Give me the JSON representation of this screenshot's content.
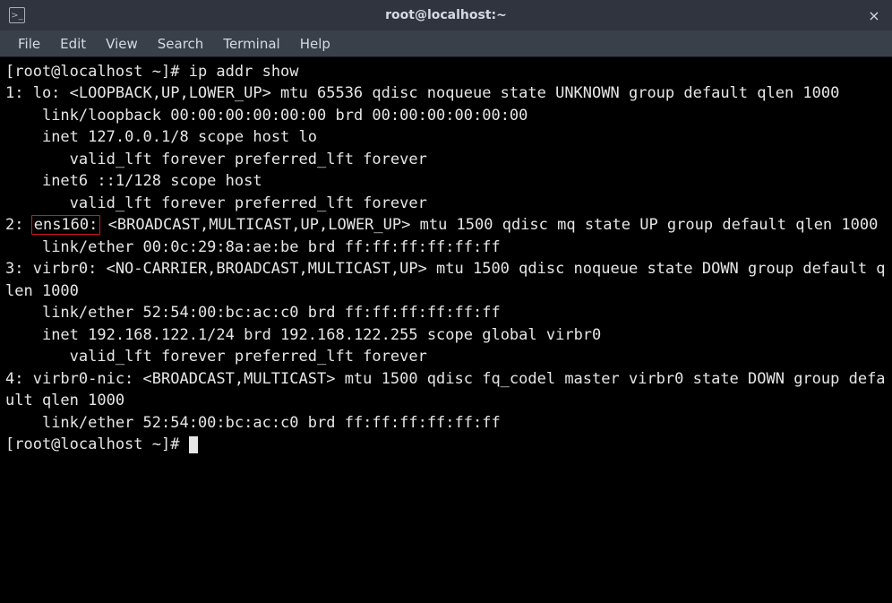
{
  "window": {
    "icon_glyph": ">_",
    "title": "root@localhost:~",
    "close_glyph": "×"
  },
  "menu": {
    "items": [
      "File",
      "Edit",
      "View",
      "Search",
      "Terminal",
      "Help"
    ]
  },
  "terminal": {
    "prompt1_pre": "[root@localhost ~]# ",
    "cmd1": "ip addr show",
    "if1_a": "1: lo: <LOOPBACK,UP,LOWER_UP> mtu 65536 qdisc noqueue state UNKNOWN group default qlen 1000",
    "if1_b": "    link/loopback 00:00:00:00:00:00 brd 00:00:00:00:00:00",
    "if1_c": "    inet 127.0.0.1/8 scope host lo",
    "if1_d": "       valid_lft forever preferred_lft forever",
    "if1_e": "    inet6 ::1/128 scope host",
    "if1_f": "       valid_lft forever preferred_lft forever",
    "if2_pre": "2: ",
    "if2_hl": "ens160:",
    "if2_post": " <BROADCAST,MULTICAST,UP,LOWER_UP> mtu 1500 qdisc mq state UP group default qlen 1000",
    "if2_b": "    link/ether 00:0c:29:8a:ae:be brd ff:ff:ff:ff:ff:ff",
    "if3_a": "3: virbr0: <NO-CARRIER,BROADCAST,MULTICAST,UP> mtu 1500 qdisc noqueue state DOWN group default qlen 1000",
    "if3_b": "    link/ether 52:54:00:bc:ac:c0 brd ff:ff:ff:ff:ff:ff",
    "if3_c": "    inet 192.168.122.1/24 brd 192.168.122.255 scope global virbr0",
    "if3_d": "       valid_lft forever preferred_lft forever",
    "if4_a": "4: virbr0-nic: <BROADCAST,MULTICAST> mtu 1500 qdisc fq_codel master virbr0 state DOWN group default qlen 1000",
    "if4_b": "    link/ether 52:54:00:bc:ac:c0 brd ff:ff:ff:ff:ff:ff",
    "prompt2_pre": "[root@localhost ~]# "
  }
}
